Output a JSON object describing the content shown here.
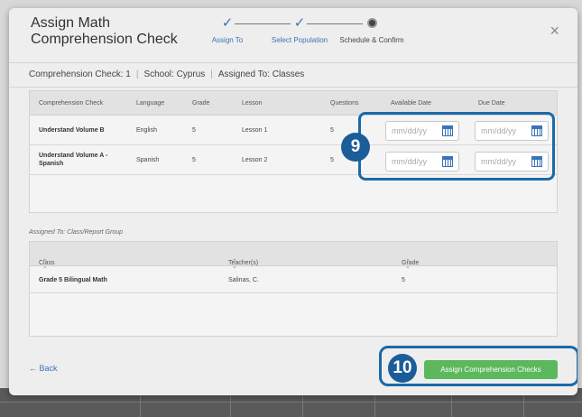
{
  "modal": {
    "title": "Assign Math Comprehension Check",
    "close_glyph": "×"
  },
  "stepper": {
    "steps": [
      {
        "label": "Assign To",
        "status": "complete",
        "mark": "✓"
      },
      {
        "label": "Select Population",
        "status": "complete",
        "mark": "✓"
      },
      {
        "label": "Schedule & Confirm",
        "status": "current"
      }
    ]
  },
  "summary": {
    "check": "Comprehension Check: 1",
    "school": "School: Cyprus",
    "assigned": "Assigned To: Classes"
  },
  "checks_table": {
    "headers": [
      "Comprehension Check",
      "Language",
      "Grade",
      "Lesson",
      "Questions",
      "Available Date",
      "Due Date"
    ],
    "rows": [
      {
        "name": "Understand Volume B",
        "language": "English",
        "grade": "5",
        "lesson": "Lesson 1",
        "questions": "5",
        "available_placeholder": "mm/dd/yy",
        "due_placeholder": "mm/dd/yy"
      },
      {
        "name": "Understand Volume A - Spanish",
        "language": "Spanish",
        "grade": "5",
        "lesson": "Lesson 2",
        "questions": "5",
        "available_placeholder": "mm/dd/yy",
        "due_placeholder": "mm/dd/yy"
      }
    ]
  },
  "callouts": {
    "dates": "9",
    "assign": "10"
  },
  "assigned_to": {
    "label": "Assigned To: Class/Report Group",
    "headers": [
      "Class",
      "Teacher(s)",
      "Grade"
    ],
    "rows": [
      {
        "class": "Grade 5 Bilingual Math",
        "teacher": "Salinas, C.",
        "grade": "5"
      }
    ]
  },
  "footer": {
    "back_label": "← Back",
    "assign_label": "Assign Comprehension Checks"
  },
  "colors": {
    "accent_blue": "#3b73b9",
    "callout_blue": "#1b5d99",
    "primary_green": "#5cb85c"
  }
}
